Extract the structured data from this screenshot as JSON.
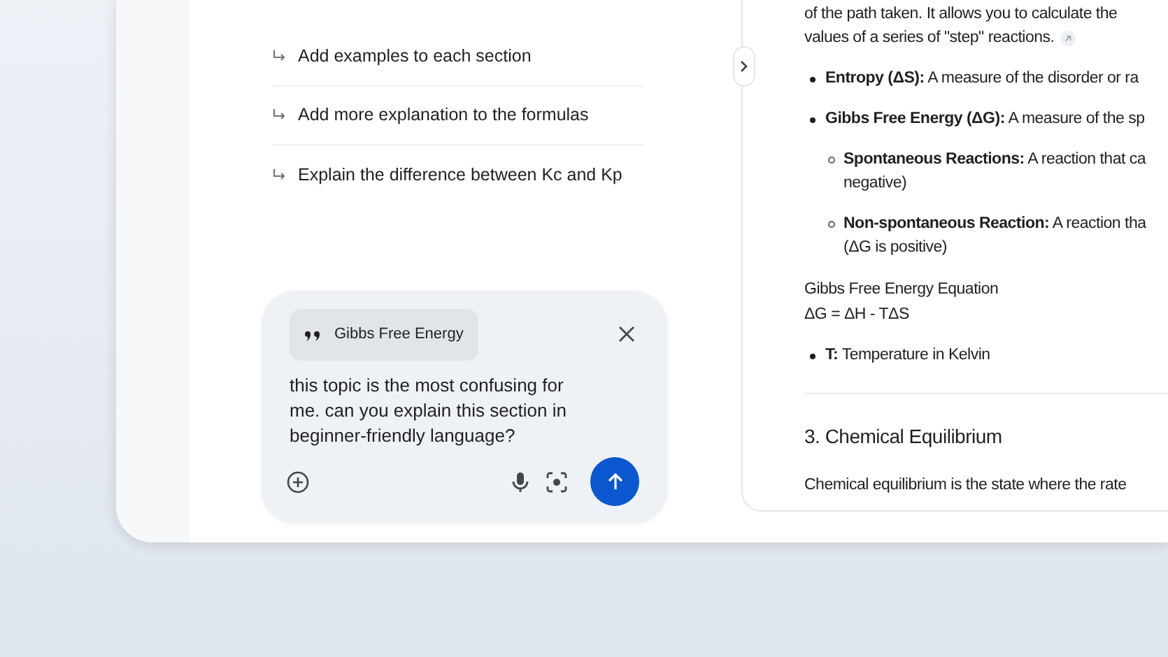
{
  "suggestions": [
    "Add examples to each section",
    "Add more explanation to the formulas",
    "Explain the difference between Kc and Kp"
  ],
  "composer": {
    "quote": "Gibbs Free Energy",
    "message": "this topic is the most confusing for me. can you explain this section in beginner-friendly language?"
  },
  "document": [
    {
      "kind": "paragraph",
      "lines": [
        "of the path taken. It allows you to calculate the",
        "values of a series of \"step\" reactions."
      ],
      "citation": true
    },
    {
      "kind": "bullet",
      "lines": [
        "**Entropy (ΔS):** A measure of the disorder or ra"
      ]
    },
    {
      "kind": "bullet",
      "lines": [
        "**Gibbs Free Energy (ΔG):** A measure of the sp"
      ]
    },
    {
      "kind": "sub_bullet",
      "lines": [
        "**Spontaneous Reactions:** A reaction that ca",
        "negative)"
      ]
    },
    {
      "kind": "sub_bullet",
      "lines": [
        "**Non-spontaneous Reaction:** A reaction tha",
        "(ΔG is positive)"
      ]
    },
    {
      "kind": "label",
      "lines": [
        "Gibbs Free Energy Equation",
        "ΔG = ΔH - TΔS"
      ]
    },
    {
      "kind": "bullet",
      "lines": [
        "**T:** Temperature in Kelvin"
      ]
    },
    {
      "kind": "rule"
    },
    {
      "kind": "heading",
      "lines": [
        "3. Chemical Equilibrium"
      ]
    },
    {
      "kind": "paragraph",
      "lines": [
        "Chemical equilibrium is the state where the rate"
      ],
      "citation": false
    }
  ]
}
